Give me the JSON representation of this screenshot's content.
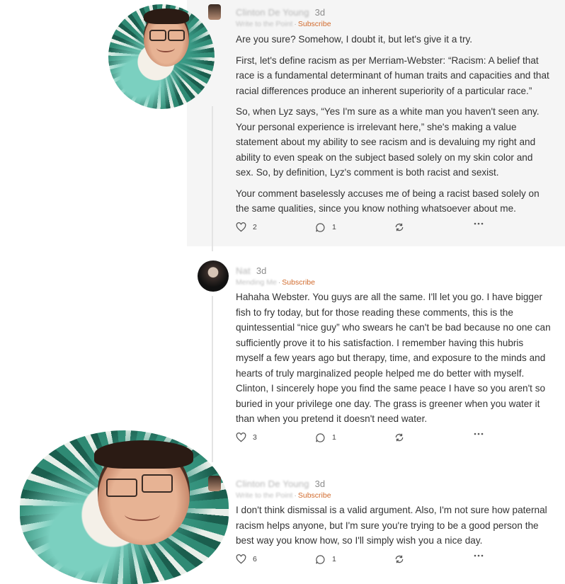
{
  "comments": [
    {
      "author": "Clinton De Young",
      "age": "3d",
      "publication": "Write to the Point",
      "separator": "·",
      "subscribe_label": "Subscribe",
      "paragraphs": [
        "Are you sure? Somehow, I doubt it, but let's give it a try.",
        "First, let's define racism as per Merriam-Webster: “Racism: A belief that race is a fundamental determinant of human traits and capacities and that racial differences produce an inherent superiority of a particular race.”",
        "So, when Lyz says, “Yes I'm sure as a white man you haven't seen any. Your personal experience is irrelevant here,” she's making a value statement about my ability to see racism and is devaluing my right and ability to even speak on the subject based solely on my skin color and sex. So, by definition, Lyz's comment is both racist and sexist.",
        "Your comment baselessly accuses me of being a racist based solely on the same qualities, since you know nothing whatsoever about me."
      ],
      "likes": "2",
      "replies": "1"
    },
    {
      "author": "Nat",
      "age": "3d",
      "publication": "Mending Me",
      "separator": "·",
      "subscribe_label": "Subscribe",
      "paragraphs": [
        "Hahaha Webster. You guys are all the same. I'll let you go. I have bigger fish to fry today, but for those reading these comments, this is the quintessential “nice guy” who swears he can't be bad because no one can sufficiently prove it to his satisfaction. I remember having this hubris myself a few years ago but therapy, time, and exposure to the minds and hearts of truly marginalized people helped me do better with myself. Clinton, I sincerely hope you find the same peace I have so you aren't so buried in your privilege one day. The grass is greener when you water it than when you pretend it doesn't need water."
      ],
      "likes": "3",
      "replies": "1"
    },
    {
      "author": "Clinton De Young",
      "age": "3d",
      "publication": "Write to the Point",
      "separator": "·",
      "subscribe_label": "Subscribe",
      "paragraphs": [
        "I don't think dismissal is a valid argument. Also, I'm not sure how paternal racism helps anyone, but I'm sure you're trying to be a good person the best way you know how, so I'll simply wish you a nice day."
      ],
      "likes": "6",
      "replies": "1"
    }
  ],
  "icons": {
    "like": "heart-icon",
    "reply": "speech-bubble-icon",
    "restack": "restack-icon",
    "more": "ellipsis-icon"
  },
  "colors": {
    "subscribe": "#d16a2c",
    "panel_background": "#f5f5f5",
    "thread_line": "#e4e4e4"
  }
}
